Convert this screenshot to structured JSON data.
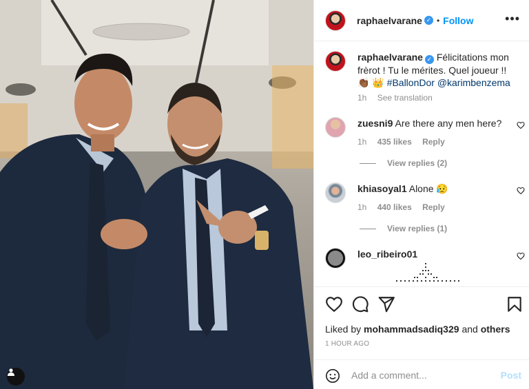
{
  "post": {
    "username": "raphaelvarane",
    "verified_icon": "verified-badge-icon",
    "dot": "•",
    "follow_label": "Follow",
    "more_icon": "more-options-icon"
  },
  "caption": {
    "username": "raphaelvarane",
    "text": "Félicitations mon frèrot ! Tu le mérites. Quel joueur !! 👏🏾 👑",
    "hashtag": "#BallonDor",
    "mention": "@karimbenzema",
    "time": "1h",
    "translation": "See translation"
  },
  "comments": [
    {
      "username": "zuesni9",
      "text": "Are there any men here?",
      "time": "1h",
      "likes": "435 likes",
      "reply": "Reply",
      "view_replies": "View replies (2)"
    },
    {
      "username": "khiasoyal1",
      "text": "Alone 😥",
      "time": "1h",
      "likes": "440 likes",
      "reply": "Reply",
      "view_replies": "View replies (1)"
    },
    {
      "username": "leo_ribeiro01",
      "text": ""
    }
  ],
  "actions": {
    "like_icon": "heart-icon",
    "comment_icon": "comment-icon",
    "share_icon": "share-icon",
    "save_icon": "bookmark-icon",
    "liked_prefix": "Liked by",
    "liked_user": "mohammadsadiq329",
    "liked_and": "and",
    "liked_others": "others",
    "time_ago": "1 HOUR AGO"
  },
  "add_comment": {
    "emoji_icon": "emoji-icon",
    "placeholder": "Add a comment...",
    "post_label": "Post"
  },
  "colors": {
    "accent": "#0095f6",
    "verified": "#3897f0",
    "muted": "#8e8e8e",
    "post_disabled": "#b2dffc"
  }
}
